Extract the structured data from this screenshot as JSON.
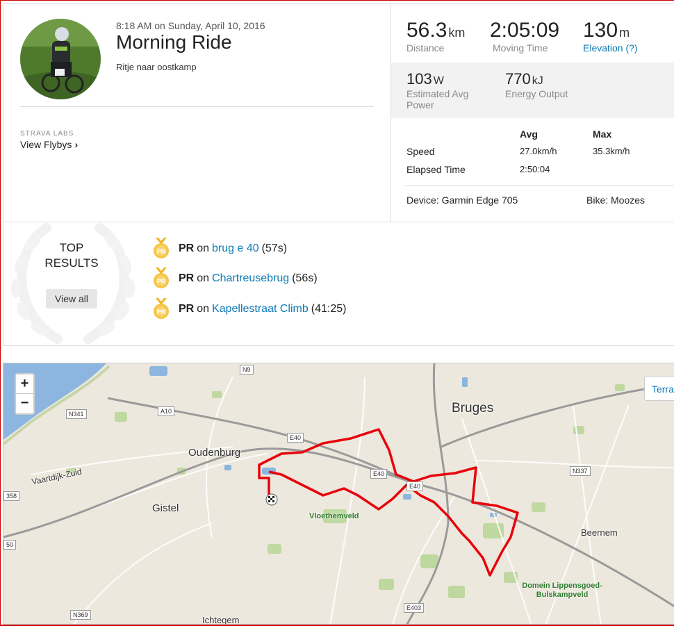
{
  "activity": {
    "datetime": "8:18 AM on Sunday, April 10, 2016",
    "title": "Morning Ride",
    "description": "Ritje naar oostkamp"
  },
  "labs": {
    "label": "STRAVA LABS",
    "flybys": "View Flybys"
  },
  "stats": {
    "distance": {
      "value": "56.3",
      "unit": "km",
      "label": "Distance"
    },
    "moving_time": {
      "value": "2:05:09",
      "label": "Moving Time"
    },
    "elevation": {
      "value": "130",
      "unit": "m",
      "label": "Elevation (?)"
    },
    "power": {
      "value": "103",
      "unit": "W",
      "label": "Estimated Avg Power"
    },
    "energy": {
      "value": "770",
      "unit": "kJ",
      "label": "Energy Output"
    }
  },
  "table": {
    "col_avg": "Avg",
    "col_max": "Max",
    "rows": [
      {
        "label": "Speed",
        "avg": "27.0km/h",
        "max": "35.3km/h"
      },
      {
        "label": "Elapsed Time",
        "avg": "2:50:04",
        "max": ""
      }
    ]
  },
  "device": "Device: Garmin Edge 705",
  "bike": "Bike: Moozes",
  "results": {
    "title": "TOP RESULTS",
    "view_all": "View all",
    "items": [
      {
        "badge": "PR",
        "prefix": "on",
        "segment": "brug e 40",
        "time": "(57s)"
      },
      {
        "badge": "PR",
        "prefix": "on",
        "segment": "Chartreusebrug",
        "time": "(56s)"
      },
      {
        "badge": "PR",
        "prefix": "on",
        "segment": "Kapellestraat Climb",
        "time": "(41:25)"
      }
    ]
  },
  "map": {
    "zoom_in": "+",
    "zoom_out": "−",
    "terrain": "Terra",
    "cities": [
      "Bruges",
      "Oudenburg",
      "Gistel",
      "Beernem",
      "Ichtegem",
      "Vaartdijk-Zuid"
    ],
    "parks": [
      "Vloethemveld",
      "Domein Lippensgoed-Bulskampveld"
    ],
    "roads": [
      "N9",
      "A10",
      "N341",
      "E40",
      "E40",
      "E40",
      "N337",
      "358",
      "50",
      "N369",
      "E403"
    ],
    "route_color": "#e8000b"
  }
}
